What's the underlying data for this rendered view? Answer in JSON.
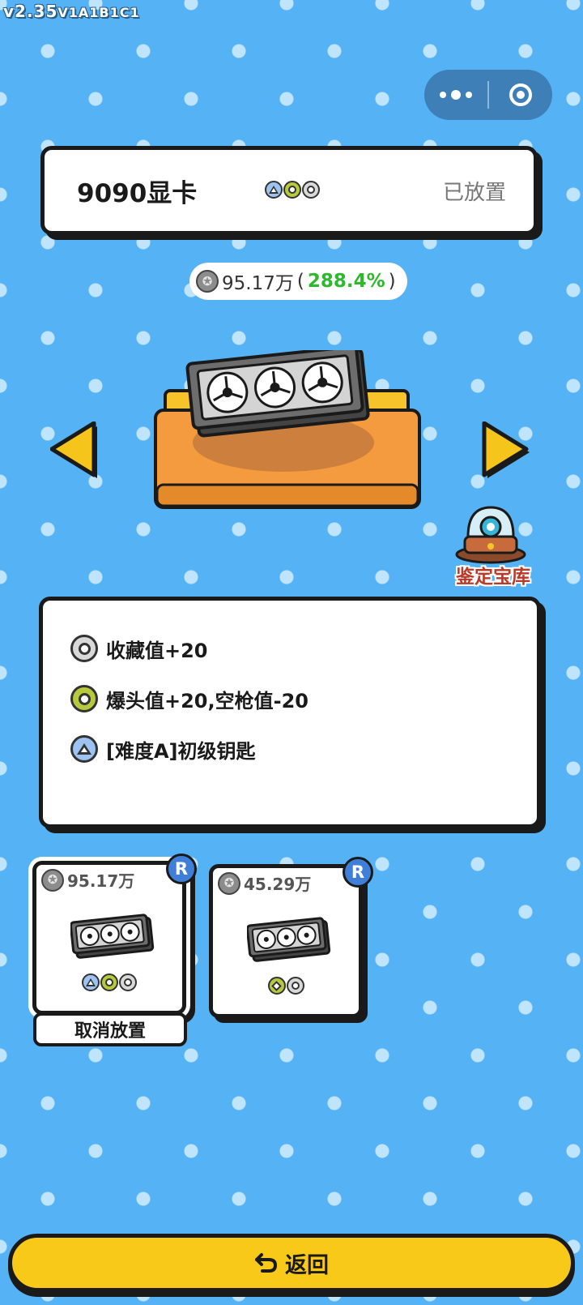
{
  "version": {
    "main": "v2.35",
    "sub": "V1A1B1C1"
  },
  "item": {
    "name": "9090显卡",
    "status": "已放置",
    "price": "95.17万",
    "open_paren": "(",
    "percent": "288.4%",
    "close_paren": ")",
    "gem_icons": [
      "triangle-blue",
      "circle-green",
      "circle-grey"
    ]
  },
  "vault": {
    "label": "鉴定宝库"
  },
  "effects": [
    {
      "icon": "circle-grey",
      "text": "收藏值+20"
    },
    {
      "icon": "circle-green",
      "text": "爆头值+20,空枪值-20"
    },
    {
      "icon": "triangle-blue",
      "text": "[难度A]初级钥匙"
    }
  ],
  "slots": [
    {
      "price": "95.17万",
      "rarity": "R",
      "selected": true,
      "action": "取消放置",
      "gem_icons": [
        "triangle-blue",
        "circle-green",
        "circle-grey"
      ]
    },
    {
      "price": "45.29万",
      "rarity": "R",
      "selected": false,
      "gem_icons": [
        "diamond-green",
        "circle-grey"
      ]
    }
  ],
  "footer": {
    "back_label": "返回",
    "back_icon": "return-icon"
  },
  "colors": {
    "background": "#55b3f5",
    "button": "#f9c91a",
    "percent": "#2db82d",
    "rarity_badge": "#3f7fd8"
  }
}
